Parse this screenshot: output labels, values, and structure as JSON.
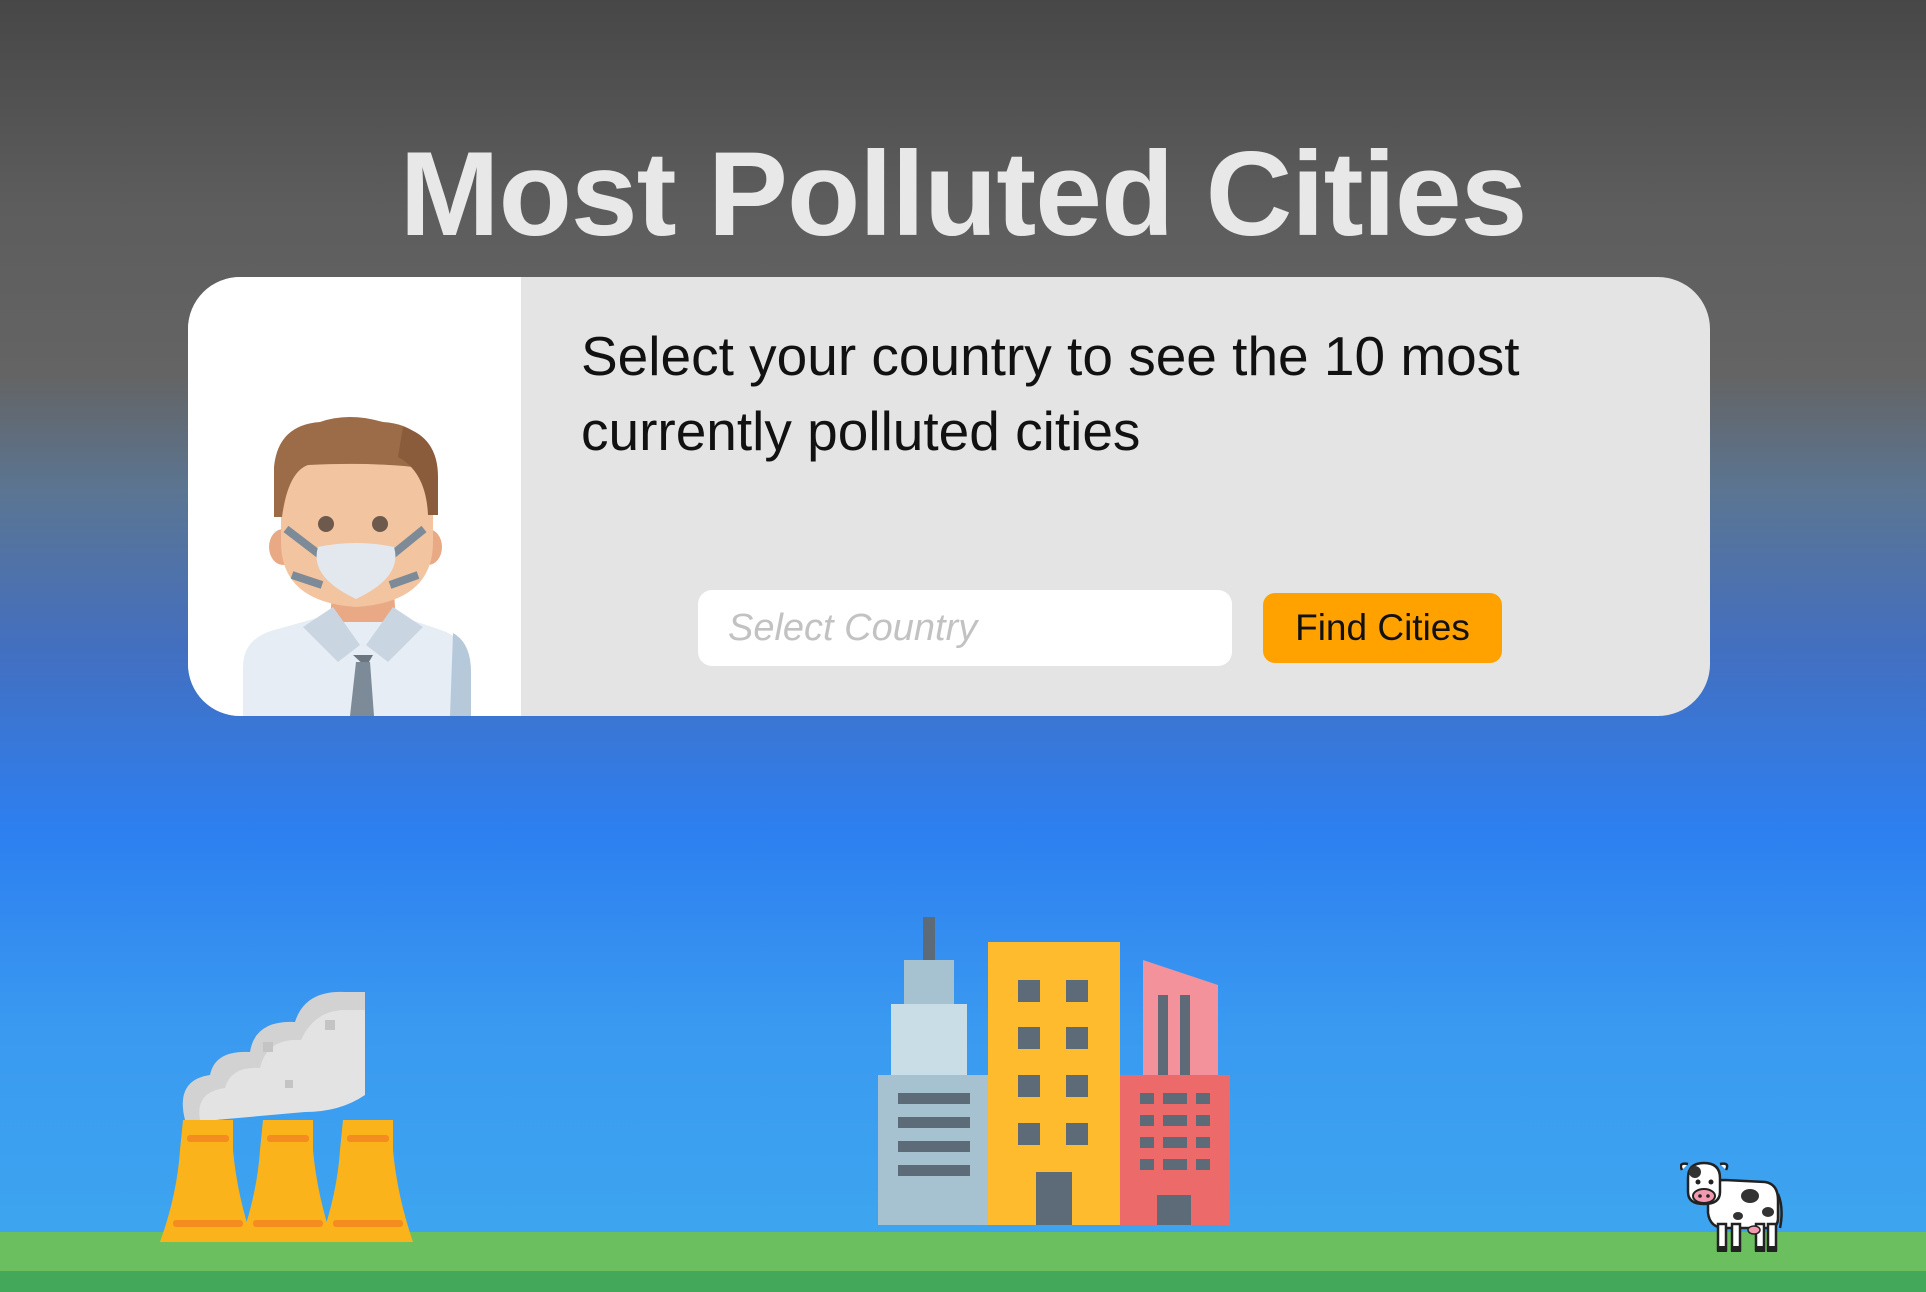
{
  "page": {
    "title": "Most Polluted Cities"
  },
  "card": {
    "description": "Select your country to see the 10 most currently polluted cities",
    "input_placeholder": "Select Country",
    "button_label": "Find Cities"
  },
  "colors": {
    "accent_button": "#ffa200",
    "card_background": "#e4e4e4",
    "ground": "#6cbf5e"
  },
  "icons": {
    "avatar": "masked-man-icon",
    "factory": "factory-smoke-icon",
    "city": "city-buildings-icon",
    "cow": "cow-icon"
  }
}
